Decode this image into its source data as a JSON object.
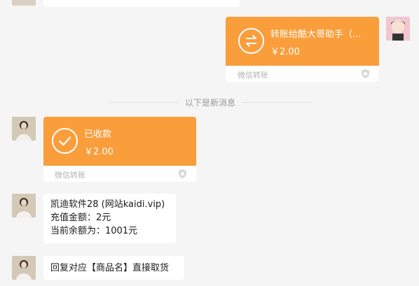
{
  "messages": {
    "sent_transfer": {
      "title": "转账给酷大哥助手（...",
      "amount": "￥2.00",
      "footer": "微信转账"
    },
    "divider": "以下是新消息",
    "received_transfer": {
      "title": "已收款",
      "amount": "￥2.00",
      "footer": "微信转账"
    },
    "info_message": {
      "line1": "凯迪软件28 (网站kaidi.vip)",
      "line2": "充值金额：2元",
      "line3": "当前余额为：1001元"
    },
    "instruction_message": {
      "text": "回复对应【商品名】直接取货"
    }
  },
  "colors": {
    "transfer_orange": "#fa9d3b",
    "background": "#f5f5f5"
  }
}
